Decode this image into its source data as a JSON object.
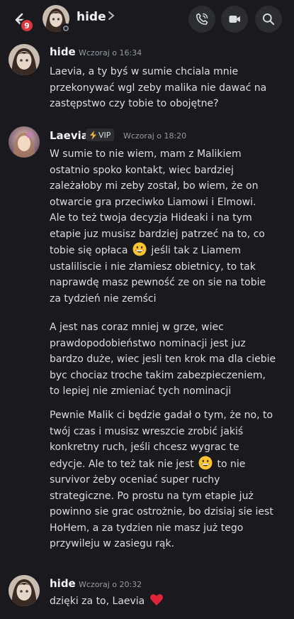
{
  "header": {
    "channel_name": "hide",
    "unread_badge": "9",
    "icons": {
      "back": "arrow-left-icon",
      "chevron": "chevron-right-icon",
      "call": "phone-icon",
      "video": "video-camera-icon",
      "search": "search-icon"
    }
  },
  "messages": [
    {
      "author": "hide",
      "timestamp": "Wczoraj o 16:34",
      "lines": [
        "Laevia, a ty byś w sumie chciala mnie",
        "przekonywać wgl zeby malika nie dawać na",
        "zastępstwo czy tobie to obojętne?"
      ]
    },
    {
      "author": "Laevia",
      "badge": "VIP",
      "timestamp": "Wczoraj o 18:20",
      "paragraphs": [
        {
          "lines": [
            "W sumie to nie wiem, mam z Malikiem",
            "ostatnio spoko kontakt, wiec bardziej",
            "zależałoby mi zeby został, bo wiem, że on",
            "otwarcie gra przeciwko Liamowi i Elmowi.",
            "Ale to też twoja decyzja Hideaki i na tym",
            "etapie juz musisz bardziej patrzeć na to, co",
            "tobie się opłaca",
            "jeśli tak z Liamem",
            "ustaliliscie i nie złamiesz obietnicy, to tak",
            "naprawdę masz pewność ze on sie na tobie",
            "za tydzień nie zemści"
          ]
        },
        {
          "lines": [
            "A jest nas coraz mniej w grze, wiec",
            "prawdopodobieństwo nominacji jest juz",
            "bardzo duże, wiec jesli ten krok ma dla ciebie",
            "byc chociaz troche takim zabezpieczeniem,",
            "to lepiej nie zmieniać tych nominacji"
          ]
        },
        {
          "lines": [
            "Pewnie Malik ci będzie gadał o tym, że no, to",
            "twój czas i musisz wreszcie zrobić jakiś",
            "konkretny ruch, jeśli chcesz wygrac te",
            "edycje. Ale to też tak nie jest",
            "to nie",
            "survivor żeby oceniać super ruchy",
            "strategiczne. Po prostu na tym etapie już",
            "powinno sie grac ostrożnie, bo dzisiaj sie iest",
            "HoHem, a za tydzien nie masz już tego",
            "przywileju w zasiegu rąk."
          ]
        }
      ]
    },
    {
      "author": "hide",
      "timestamp": "Wczoraj o 20:32",
      "lines": [
        "dzięki za to, Laevia"
      ]
    }
  ],
  "emoji": [
    "grinning-face-emoji",
    "grinning-face-emoji",
    "red-heart-emoji"
  ],
  "colors": {
    "background": "#1a1a1e",
    "badge_red": "#da373c",
    "vip_bolt": "#f0b232",
    "heart": "#e0253a"
  }
}
